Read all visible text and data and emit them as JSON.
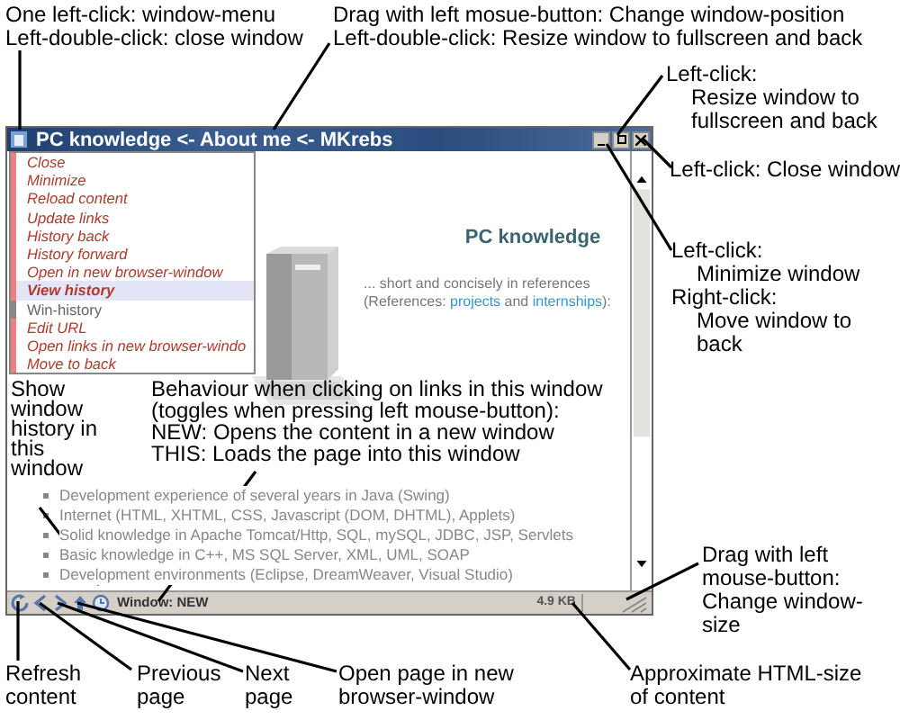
{
  "annotations": [
    {
      "lines": [
        {
          "text": "One left-click: window-menu"
        },
        {
          "text": "Left-double-click: close window"
        }
      ]
    },
    {
      "lines": [
        {
          "text": "Drag with left mosue-button: Change window-position"
        },
        {
          "text": "Left-double-click: Resize window to fullscreen and back"
        }
      ]
    },
    {
      "lines": [
        {
          "text": "Left-click:",
          "children": [
            {
              "text": "Resize window to"
            },
            {
              "text": "fullscreen and back"
            }
          ]
        }
      ]
    },
    {
      "lines": [
        {
          "text": "Left-click: Close window"
        }
      ]
    },
    {
      "lines": [
        {
          "text": "Left-click:",
          "children": [
            {
              "text": "Minimize window"
            }
          ]
        },
        {
          "text": "Right-click:",
          "children": [
            {
              "text": "Move window to"
            },
            {
              "text": "back"
            }
          ]
        }
      ]
    },
    {
      "lines": [
        {
          "text": "Show"
        },
        {
          "text": "window"
        },
        {
          "text": "history in"
        },
        {
          "text": "this"
        },
        {
          "text": "window"
        }
      ]
    },
    {
      "lines": [
        {
          "text": "Behaviour when clicking on links in this window"
        },
        {
          "text": "(toggles when pressing left mouse-button):"
        },
        {
          "text": "NEW: Opens the content in a new window"
        },
        {
          "text": "THIS: Loads the page into this window"
        }
      ]
    },
    {
      "lines": [
        {
          "text": "Drag with left"
        },
        {
          "text": "mouse-button:"
        },
        {
          "text": "Change window-"
        },
        {
          "text": "size"
        }
      ]
    },
    {
      "lines": [
        {
          "text": "Refresh"
        },
        {
          "text": "content"
        }
      ]
    },
    {
      "lines": [
        {
          "text": "Previous"
        },
        {
          "text": "page"
        }
      ]
    },
    {
      "lines": [
        {
          "text": "Next"
        },
        {
          "text": "page"
        }
      ]
    },
    {
      "lines": [
        {
          "text": "Open page in new"
        },
        {
          "text": "browser-window"
        }
      ]
    },
    {
      "lines": [
        {
          "text": "Approximate HTML-size"
        },
        {
          "text": "of content"
        }
      ]
    }
  ],
  "window": {
    "title": "PC knowledge <- About me <- MKrebs",
    "menu": [
      {
        "label": "Close",
        "selected": false,
        "disabled": false
      },
      {
        "label": "Minimize",
        "selected": false,
        "disabled": false
      },
      {
        "label": "Reload content",
        "selected": false,
        "disabled": false
      },
      {
        "label": "Update links",
        "selected": false,
        "disabled": false
      },
      {
        "label": "History back",
        "selected": false,
        "disabled": false
      },
      {
        "label": "History forward",
        "selected": false,
        "disabled": false
      },
      {
        "label": "Open in new browser-window",
        "selected": false,
        "disabled": false
      },
      {
        "label": "View history",
        "selected": true,
        "disabled": false
      },
      {
        "label": "Win-history",
        "selected": false,
        "disabled": true
      },
      {
        "label": "Edit URL",
        "selected": false,
        "disabled": false
      },
      {
        "label": "Open links in new browser-windo",
        "selected": false,
        "disabled": false
      },
      {
        "label": "Move to back",
        "selected": false,
        "disabled": false
      }
    ],
    "heading": "PC knowledge",
    "intro": {
      "before": "... short and concisely in references (References: ",
      "link1": "projects",
      "middle": " and ",
      "link2": "internships",
      "after": "):"
    },
    "bullets": [
      "Development experience of several years in Java (Swing)",
      "Internet (HTML, XHTML, CSS, Javascript (DOM, DHTML), Applets)",
      "Solid knowledge in Apache Tomcat/Http, SQL, mySQL, JDBC, JSP, Servlets",
      "Basic knowledge in C++, MS SQL Server, XML, UML, SOAP",
      "Development environments (Eclipse, DreamWeaver, Visual Studio)"
    ],
    "status": {
      "mode": "Window: NEW",
      "size": "4.9 KB"
    }
  }
}
